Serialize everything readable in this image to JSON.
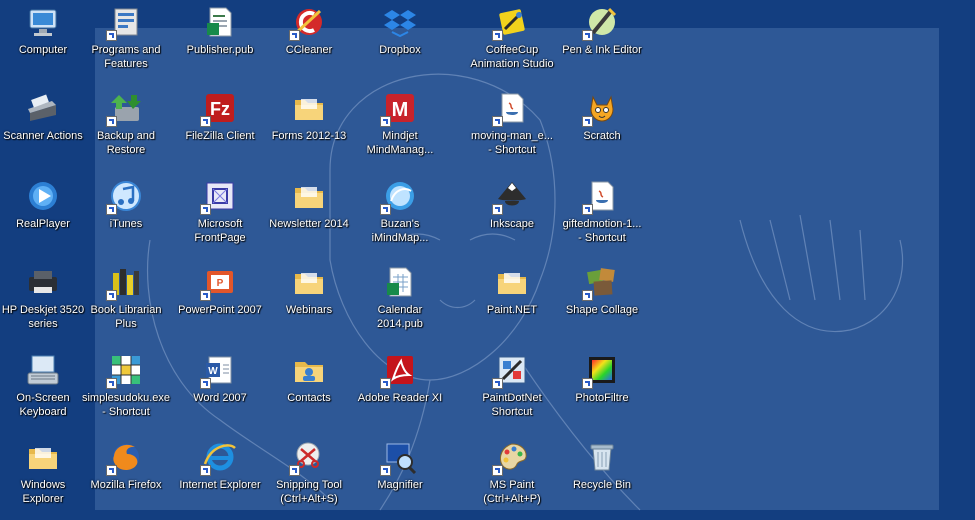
{
  "desktop": {
    "icons": [
      {
        "label": "Computer",
        "icon": "computer-icon",
        "shortcut": false
      },
      {
        "label": "Scanner Actions",
        "icon": "scanner-icon",
        "shortcut": false
      },
      {
        "label": "RealPlayer",
        "icon": "realplayer-icon",
        "shortcut": false
      },
      {
        "label": "HP Deskjet 3520\nseries",
        "icon": "printer-icon",
        "shortcut": false
      },
      {
        "label": "On-Screen\nKeyboard",
        "icon": "keyboard-icon",
        "shortcut": false
      },
      {
        "label": "Windows Explorer",
        "icon": "folder-icon",
        "shortcut": false
      },
      {
        "label": "Programs and\nFeatures",
        "icon": "programs-icon",
        "shortcut": true
      },
      {
        "label": "Backup and\nRestore",
        "icon": "backup-icon",
        "shortcut": true
      },
      {
        "label": "iTunes",
        "icon": "itunes-icon",
        "shortcut": true
      },
      {
        "label": "Book Librarian\nPlus",
        "icon": "books-icon",
        "shortcut": true
      },
      {
        "label": "simplesudoku.exe\n- Shortcut",
        "icon": "sudoku-icon",
        "shortcut": true
      },
      {
        "label": "Mozilla Firefox",
        "icon": "firefox-icon",
        "shortcut": true
      },
      {
        "label": "Publisher.pub",
        "icon": "publisher-doc-icon",
        "shortcut": false
      },
      {
        "label": "FileZilla Client",
        "icon": "filezilla-icon",
        "shortcut": true
      },
      {
        "label": "Microsoft\nFrontPage",
        "icon": "frontpage-icon",
        "shortcut": true
      },
      {
        "label": "PowerPoint 2007",
        "icon": "powerpoint-icon",
        "shortcut": true
      },
      {
        "label": "Word 2007",
        "icon": "word-icon",
        "shortcut": true
      },
      {
        "label": "Internet Explorer",
        "icon": "ie-icon",
        "shortcut": true
      },
      {
        "label": "CCleaner",
        "icon": "ccleaner-icon",
        "shortcut": true
      },
      {
        "label": "Forms 2012-13",
        "icon": "folder-icon",
        "shortcut": false
      },
      {
        "label": "Newsletter 2014",
        "icon": "folder-icon",
        "shortcut": false
      },
      {
        "label": "Webinars",
        "icon": "folder-icon",
        "shortcut": false
      },
      {
        "label": "Contacts",
        "icon": "contacts-folder-icon",
        "shortcut": false
      },
      {
        "label": "Snipping Tool\n(Ctrl+Alt+S)",
        "icon": "scissors-icon",
        "shortcut": true
      },
      {
        "label": "Dropbox",
        "icon": "dropbox-icon",
        "shortcut": false
      },
      {
        "label": "Mindjet\nMindManag...",
        "icon": "mindjet-icon",
        "shortcut": true
      },
      {
        "label": "Buzan's\niMindMap...",
        "icon": "imindmap-icon",
        "shortcut": true
      },
      {
        "label": "Calendar\n2014.pub",
        "icon": "calendar-doc-icon",
        "shortcut": false
      },
      {
        "label": "Adobe Reader XI",
        "icon": "adobe-reader-icon",
        "shortcut": true
      },
      {
        "label": "Magnifier",
        "icon": "magnifier-icon",
        "shortcut": true
      },
      {
        "label": "CoffeeCup\nAnimation Studio",
        "icon": "coffeecup-icon",
        "shortcut": true
      },
      {
        "label": "moving-man_e...\n- Shortcut",
        "icon": "java-doc-icon",
        "shortcut": true
      },
      {
        "label": "Inkscape",
        "icon": "inkscape-icon",
        "shortcut": true
      },
      {
        "label": "Paint.NET",
        "icon": "folder-icon",
        "shortcut": false
      },
      {
        "label": "PaintDotNet\nShortcut",
        "icon": "paintdotnet-icon",
        "shortcut": true
      },
      {
        "label": "MS Paint\n(Ctrl+Alt+P)",
        "icon": "palette-icon",
        "shortcut": true
      },
      {
        "label": "Pen & Ink Editor",
        "icon": "pen-icon",
        "shortcut": true
      },
      {
        "label": "Scratch",
        "icon": "scratch-cat-icon",
        "shortcut": true
      },
      {
        "label": "giftedmotion-1...\n- Shortcut",
        "icon": "java-doc-icon",
        "shortcut": true
      },
      {
        "label": "Shape Collage",
        "icon": "collage-icon",
        "shortcut": true
      },
      {
        "label": "PhotoFiltre",
        "icon": "photofiltre-icon",
        "shortcut": true
      },
      {
        "label": "Recycle Bin",
        "icon": "recycle-bin-icon",
        "shortcut": false
      }
    ]
  },
  "colors": {
    "desktop_background": "#133e80",
    "wallpaper_panel": "#2e5896",
    "label_text": "#ffffff"
  }
}
